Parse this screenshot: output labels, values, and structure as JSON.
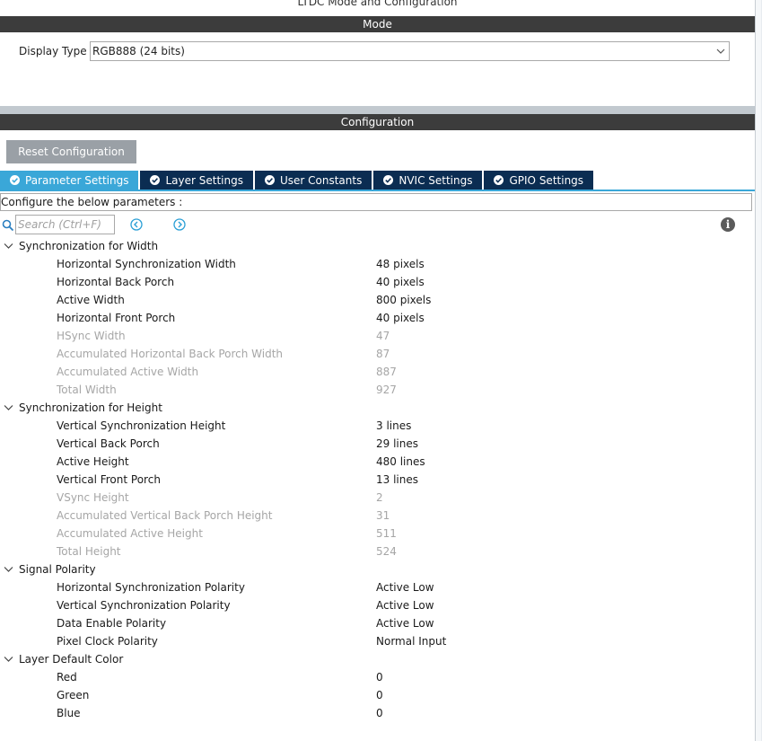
{
  "window": {
    "title": "LTDC Mode and Configuration"
  },
  "mode": {
    "header": "Mode",
    "display_type_label": "Display Type",
    "display_type_value": "RGB888 (24 bits)"
  },
  "configuration": {
    "header": "Configuration",
    "reset_label": "Reset Configuration",
    "tabs": [
      {
        "label": "Parameter Settings",
        "active": true
      },
      {
        "label": "Layer Settings",
        "active": false
      },
      {
        "label": "User Constants",
        "active": false
      },
      {
        "label": "NVIC Settings",
        "active": false
      },
      {
        "label": "GPIO Settings",
        "active": false
      }
    ],
    "configure_text": "Configure the below parameters :",
    "search_placeholder": "Search (Ctrl+F)",
    "groups": [
      {
        "label": "Synchronization for Width",
        "params": [
          {
            "name": "Horizontal Synchronization Width",
            "value": "48 pixels",
            "enabled": true
          },
          {
            "name": "Horizontal Back Porch",
            "value": "40 pixels",
            "enabled": true
          },
          {
            "name": "Active Width",
            "value": "800 pixels",
            "enabled": true
          },
          {
            "name": "Horizontal Front Porch",
            "value": "40 pixels",
            "enabled": true
          },
          {
            "name": "HSync Width",
            "value": "47",
            "enabled": false
          },
          {
            "name": "Accumulated Horizontal Back Porch Width",
            "value": "87",
            "enabled": false
          },
          {
            "name": "Accumulated Active Width",
            "value": "887",
            "enabled": false
          },
          {
            "name": "Total Width",
            "value": "927",
            "enabled": false
          }
        ]
      },
      {
        "label": "Synchronization for Height",
        "params": [
          {
            "name": "Vertical Synchronization Height",
            "value": "3 lines",
            "enabled": true
          },
          {
            "name": "Vertical Back Porch",
            "value": "29 lines",
            "enabled": true
          },
          {
            "name": "Active Height",
            "value": "480 lines",
            "enabled": true
          },
          {
            "name": "Vertical Front Porch",
            "value": "13 lines",
            "enabled": true
          },
          {
            "name": "VSync Height",
            "value": "2",
            "enabled": false
          },
          {
            "name": "Accumulated Vertical Back Porch Height",
            "value": "31",
            "enabled": false
          },
          {
            "name": "Accumulated Active Height",
            "value": "511",
            "enabled": false
          },
          {
            "name": "Total Height",
            "value": "524",
            "enabled": false
          }
        ]
      },
      {
        "label": "Signal Polarity",
        "params": [
          {
            "name": "Horizontal Synchronization Polarity",
            "value": "Active Low",
            "enabled": true
          },
          {
            "name": "Vertical Synchronization Polarity",
            "value": "Active Low",
            "enabled": true
          },
          {
            "name": "Data Enable Polarity",
            "value": "Active Low",
            "enabled": true
          },
          {
            "name": "Pixel Clock Polarity",
            "value": "Normal Input",
            "enabled": true
          }
        ]
      },
      {
        "label": "Layer Default Color",
        "params": [
          {
            "name": "Red",
            "value": "0",
            "enabled": true
          },
          {
            "name": "Green",
            "value": "0",
            "enabled": true
          },
          {
            "name": "Blue",
            "value": "0",
            "enabled": true
          }
        ]
      }
    ]
  },
  "icons": {
    "search": "search-icon",
    "prev": "chevron-left-circle-icon",
    "next": "chevron-right-circle-icon",
    "info": "info-icon",
    "dropdown": "chevron-down-icon",
    "tab_check": "check-circle-icon",
    "group_toggle": "chevron-down-icon"
  },
  "colors": {
    "header_bg": "#3c3c3c",
    "tab_active": "#3aa7d8",
    "tab_inactive": "#0b2d52",
    "reset_button": "#9aa0a6",
    "disabled_text": "#a6a6a6"
  }
}
